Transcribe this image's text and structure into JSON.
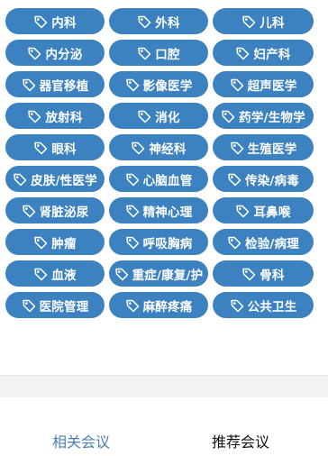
{
  "categories": [
    "内科",
    "外科",
    "儿科",
    "内分泌",
    "口腔",
    "妇产科",
    "器官移植",
    "影像医学",
    "超声医学",
    "放射科",
    "消化",
    "药学/生物学",
    "眼科",
    "神经科",
    "生殖医学",
    "皮肤/性医学",
    "心脑血管",
    "传染/病毒",
    "肾脏泌尿",
    "精神心理",
    "耳鼻喉",
    "肿瘤",
    "呼吸胸病",
    "检验/病理",
    "血液",
    "重症/康复/护",
    "骨科",
    "医院管理",
    "麻醉疼痛",
    "公共卫生"
  ],
  "tag_icon": "tag-icon",
  "tabs": {
    "related": "相关会议",
    "recommend": "推荐会议"
  },
  "colors": {
    "tag_bg": "#3d82c0",
    "tag_text": "#ffffff",
    "tab_active": "#4a7fb8",
    "tab_inactive": "#111111"
  }
}
